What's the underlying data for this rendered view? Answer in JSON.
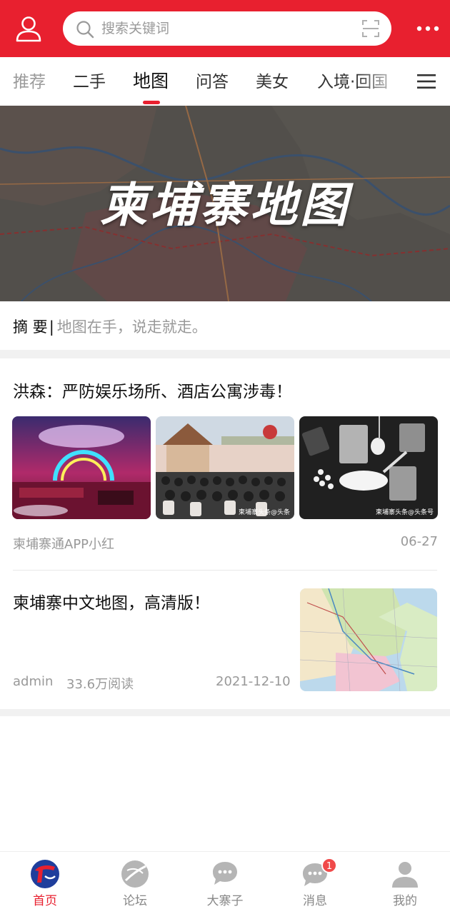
{
  "header": {
    "search_placeholder": "搜索关键词",
    "icons": [
      "user-icon",
      "search-icon",
      "scan-icon",
      "more-icon"
    ],
    "brand_color": "#e8202f"
  },
  "tabs": [
    {
      "label": "推荐",
      "state": "faded"
    },
    {
      "label": "二手",
      "state": "normal"
    },
    {
      "label": "地图",
      "state": "active"
    },
    {
      "label": "问答",
      "state": "normal"
    },
    {
      "label": "美女",
      "state": "normal"
    },
    {
      "label": "入境·回国",
      "state": "normal"
    }
  ],
  "banner": {
    "title": "柬埔寨地图"
  },
  "summary": {
    "label": "摘 要",
    "separator": "|",
    "text": "地图在手，说走就走。"
  },
  "articles": [
    {
      "title": "洪森：严防娱乐场所、酒店公寓涉毒！",
      "author": "柬埔寨通APP小红",
      "date": "06-27",
      "thumb_watermarks": [
        "柬埔寨头条@头条",
        "柬埔寨头条@头条号"
      ]
    },
    {
      "title": "柬埔寨中文地图，高清版！",
      "author": "admin",
      "reads": "33.6万阅读",
      "date": "2021-12-10"
    }
  ],
  "bottom_nav": [
    {
      "label": "首页",
      "icon": "home-logo-icon",
      "active": true
    },
    {
      "label": "论坛",
      "icon": "forum-icon",
      "active": false
    },
    {
      "label": "大寨子",
      "icon": "chat-bubbles-icon",
      "active": false
    },
    {
      "label": "消息",
      "icon": "message-icon",
      "active": false,
      "badge": "1"
    },
    {
      "label": "我的",
      "icon": "profile-icon",
      "active": false
    }
  ]
}
